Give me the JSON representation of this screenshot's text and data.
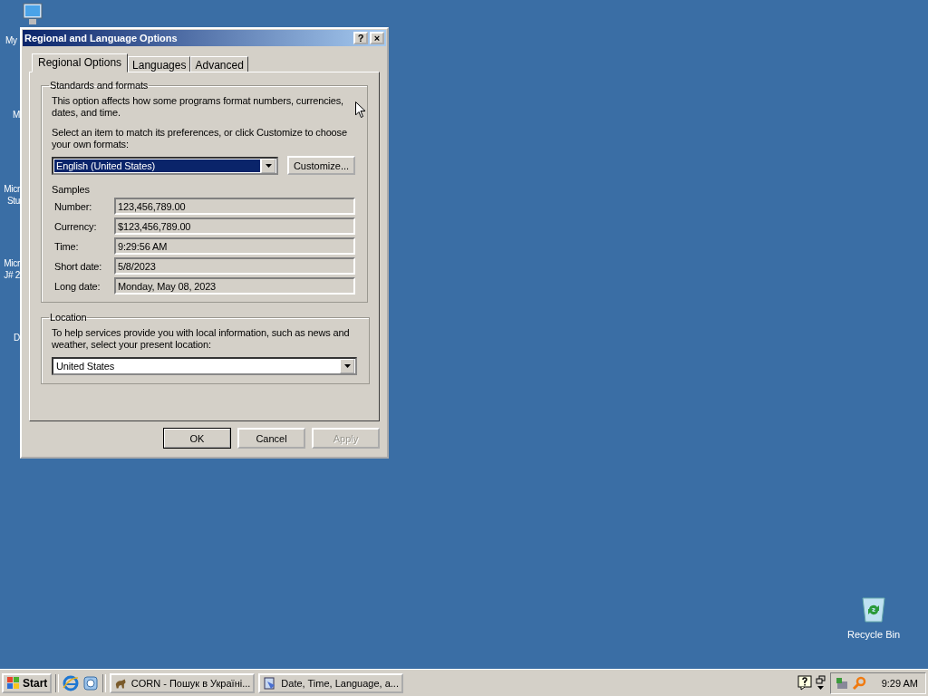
{
  "desktop_icons": [
    {
      "lines": [
        "My"
      ],
      "kind": "computer"
    },
    {
      "lines": [
        "M"
      ],
      "kind": "none"
    },
    {
      "lines": [
        "Micr",
        "Stu"
      ],
      "kind": "none"
    },
    {
      "lines": [
        "Micr",
        "J# 2"
      ],
      "kind": "none"
    },
    {
      "lines": [
        "D"
      ],
      "kind": "none"
    },
    {
      "lines": [
        "Recycle Bin"
      ],
      "kind": "recycle"
    }
  ],
  "window": {
    "title": "Regional and Language Options",
    "help_button": "?",
    "close_button": "×"
  },
  "tabs": [
    {
      "label": "Regional Options",
      "selected": true
    },
    {
      "label": "Languages",
      "selected": false
    },
    {
      "label": "Advanced",
      "selected": false
    }
  ],
  "standards": {
    "title": "Standards and formats",
    "description": "This option affects how some programs format numbers, currencies, dates, and time.",
    "instruction": "Select an item to match its preferences, or click Customize to choose your own formats:",
    "format": {
      "value": "English (United States)",
      "focused": true
    },
    "customize_button": "Customize...",
    "samples_title": "Samples",
    "samples": [
      {
        "label": "Number:",
        "value": "123,456,789.00"
      },
      {
        "label": "Currency:",
        "value": "$123,456,789.00"
      },
      {
        "label": "Time:",
        "value": "9:29:56 AM"
      },
      {
        "label": "Short date:",
        "value": "5/8/2023"
      },
      {
        "label": "Long date:",
        "value": "Monday, May 08, 2023"
      }
    ]
  },
  "location": {
    "title": "Location",
    "description": "To help services provide you with local information, such as news and weather, select your present location:",
    "value": "United States"
  },
  "buttons": [
    {
      "label": "OK",
      "default": true,
      "disabled": false
    },
    {
      "label": "Cancel",
      "default": false,
      "disabled": false
    },
    {
      "label": "Apply",
      "default": false,
      "disabled": true
    }
  ],
  "taskbar": {
    "start": "Start",
    "tasks": [
      {
        "label": "CORN - Пошук в Україні...",
        "selected": false,
        "kind": "dog"
      },
      {
        "label": "Date, Time, Language, a...",
        "selected": false,
        "kind": "panel"
      }
    ],
    "clock": "9:29 AM"
  }
}
